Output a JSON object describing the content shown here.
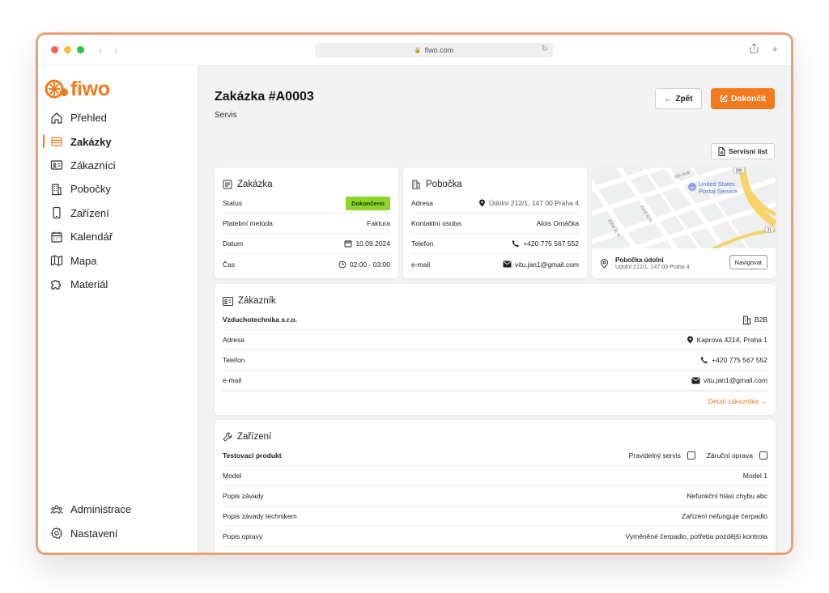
{
  "browser": {
    "url": "fiwo.com"
  },
  "sidebar": {
    "logo": "fiwo",
    "items": [
      {
        "label": "Přehled"
      },
      {
        "label": "Zakázky"
      },
      {
        "label": "Zákazníci"
      },
      {
        "label": "Pobočky"
      },
      {
        "label": "Zařízení"
      },
      {
        "label": "Kalendář"
      },
      {
        "label": "Mapa"
      },
      {
        "label": "Materiál"
      }
    ],
    "bottom_items": [
      {
        "label": "Administrace"
      },
      {
        "label": "Nastavení"
      }
    ],
    "active_index": 1
  },
  "header": {
    "title": "Zakázka #A0003",
    "subtitle": "Servis",
    "back_label": "Zpět",
    "done_label": "Dokončit",
    "sheet_label": "Servisní list"
  },
  "order_card": {
    "title": "Zakázka",
    "rows": [
      {
        "label": "Status",
        "value": "Dokončeno"
      },
      {
        "label": "Platební metoda",
        "value": "Faktura"
      },
      {
        "label": "Datum",
        "value": "10.09.2024"
      },
      {
        "label": "Čas",
        "value": "02:00 - 03:00"
      }
    ]
  },
  "branch_card": {
    "title": "Pobočka",
    "rows": [
      {
        "label": "Adresa",
        "value": "Údolní 212/1, 147 00 Praha 4"
      },
      {
        "label": "Kontaktní osoba",
        "value": "Alois Omáčka"
      },
      {
        "label": "Telefon",
        "value": "+420 775 567 552"
      },
      {
        "label": "e-mail",
        "value": "vitu.jan1@gmail.com"
      }
    ]
  },
  "map_card": {
    "labels": [
      "United States",
      "Postal Service",
      "5th Ave",
      "23rd St N",
      "22nd St N",
      "280",
      "31"
    ],
    "branch_name": "Pobočka údolní",
    "branch_address": "Údolní 212/1, 147 00 Praha 4",
    "navigate_label": "Navigovat"
  },
  "customer_card": {
    "title": "Zákazník",
    "name": "Vzduchotechnika s.r.o.",
    "type": "B2B",
    "rows": [
      {
        "label": "Adresa",
        "value": "Kaprova 4214, Praha 1"
      },
      {
        "label": "Telefon",
        "value": "+420 775 567 552"
      },
      {
        "label": "e-mail",
        "value": "vitu.jan1@gmail.com"
      }
    ],
    "detail_link": "Detail zákazníka →"
  },
  "device_card": {
    "title": "Zařízení",
    "product": "Testovací produkt",
    "check_regular": "Pravidelný servis",
    "check_warranty": "Záruční oprava",
    "rows": [
      {
        "label": "Model",
        "value": "Model 1"
      },
      {
        "label": "Popis závady",
        "value": "Nefunkční hlásí chybu abc"
      },
      {
        "label": "Popis závady technikem",
        "value": "Zařízení nefunguje čerpadlo"
      },
      {
        "label": "Popis opravy",
        "value": "Vyměněné čerpadlo, potřeba pozdější kontrola"
      }
    ]
  },
  "colors": {
    "accent": "#f47a1f",
    "status_done": "#8fd62a"
  }
}
